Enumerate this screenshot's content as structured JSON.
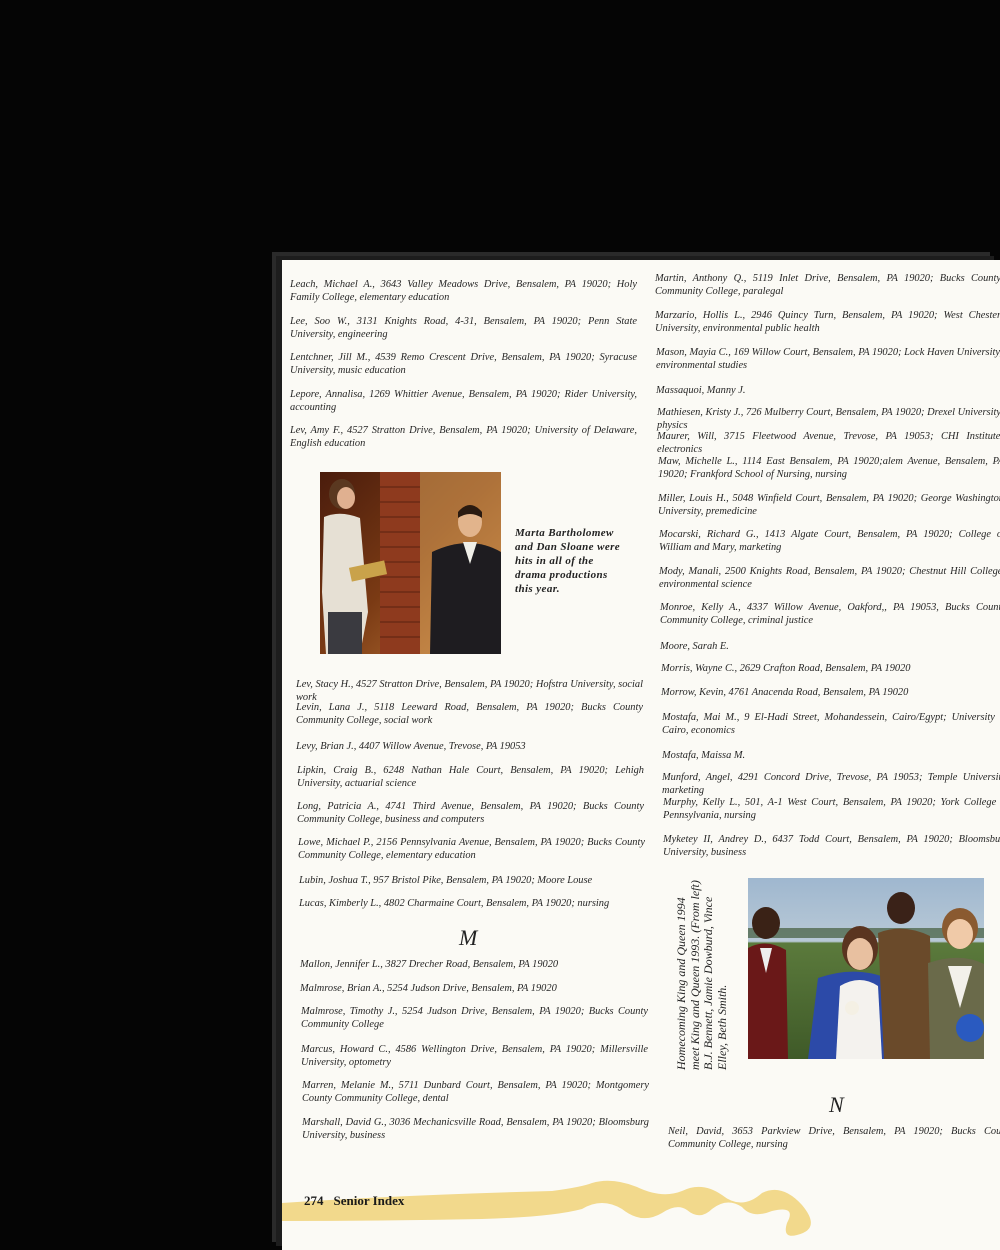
{
  "left_column": {
    "entries_top": [
      "Leach, Michael A., 3643 Valley Meadows Drive, Bensalem, PA 19020; Holy Family College, elementary education",
      "Lee, Soo W., 3131 Knights Road, 4-31, Bensalem, PA 19020; Penn State University, engineering",
      "Lentchner, Jill M., 4539 Remo Crescent Drive, Bensalem, PA 19020; Syracuse University, music education",
      "Lepore, Annalisa, 1269 Whittier Avenue, Bensalem, PA 19020; Rider University, accounting",
      "Lev, Amy F., 4527 Stratton Drive, Bensalem, PA 19020; University of Delaware, English education"
    ],
    "photo_caption": "Marta Bartholomew and Dan Sloane were hits in all of the drama productions this year.",
    "entries_middle": [
      "Lev, Stacy H., 4527 Stratton Drive, Bensalem, PA 19020; Hofstra University, social work",
      "Levin, Lana J., 5118 Leeward Road, Bensalem, PA 19020; Bucks County Community College, social work",
      "Levy, Brian J., 4407 Willow Avenue, Trevose, PA 19053",
      "Lipkin, Craig B., 6248 Nathan Hale Court, Bensalem, PA 19020; Lehigh University, actuarial science",
      "Long, Patricia A., 4741 Third Avenue, Bensalem, PA 19020; Bucks County Community College, business and computers",
      "Lowe, Michael P., 2156 Pennsylvania Avenue, Bensalem, PA 19020; Bucks County Community College, elementary education",
      "Lubin, Joshua T., 957 Bristol Pike, Bensalem, PA 19020; Moore Louse",
      "Lucas, Kimberly L., 4802 Charmaine Court, Bensalem, PA 19020; nursing"
    ],
    "section_letter": "M",
    "entries_m": [
      "Mallon, Jennifer L., 3827 Drecher Road, Bensalem, PA 19020",
      "Malmrose, Brian A., 5254 Judson Drive, Bensalem, PA 19020",
      "Malmrose, Timothy J., 5254 Judson Drive, Bensalem, PA 19020; Bucks County Community College",
      "Marcus, Howard C., 4586 Wellington Drive, Bensalem, PA 19020; Millersville University, optometry",
      "Marren, Melanie M., 5711 Dunbard Court, Bensalem, PA 19020; Montgomery County Community College, dental",
      "Marshall, David G., 3036 Mechanicsville Road, Bensalem, PA 19020; Bloomsburg University, business"
    ]
  },
  "right_column": {
    "entries": [
      "Martin, Anthony Q., 5119 Inlet Drive, Bensalem, PA 19020; Bucks County Community College, paralegal",
      "Marzario, Hollis L., 2946 Quincy Turn, Bensalem, PA 19020; West Chester University, environmental public health",
      "Mason, Mayia C., 169 Willow Court, Bensalem, PA 19020; Lock Haven University, environmental studies",
      "Massaquoi, Manny J.",
      "Mathiesen, Kristy J., 726 Mulberry Court, Bensalem, PA 19020; Drexel University, physics",
      "Maurer, Will, 3715 Fleetwood Avenue, Trevose, PA 19053; CHI Institute, electronics",
      "Maw, Michelle L., 1114 East Bensalem, PA 19020;alem Avenue, Bensalem, PA 19020; Frankford School of Nursing, nursing",
      "Miller, Louis H., 5048 Winfield Court, Bensalem, PA 19020; George Washington University, premedicine",
      "Mocarski, Richard G., 1413 Algate Court, Bensalem, PA 19020; College of William and Mary, marketing",
      "Mody, Manali, 2500 Knights Road, Bensalem, PA 19020; Chestnut Hill College, environmental science",
      "Monroe, Kelly A., 4337 Willow Avenue, Oakford,, PA 19053, Bucks County Community College, criminal justice",
      "Moore, Sarah E.",
      "Morris, Wayne C., 2629 Crafton Road, Bensalem, PA 19020",
      "Morrow, Kevin, 4761 Anacenda Road, Bensalem, PA 19020",
      "Mostafa, Mai M., 9 El-Hadi Street, Mohandessein, Cairo/Egypt; University of Cairo, economics",
      "Mostafa, Maissa M.",
      "Munford, Angel, 4291 Concord Drive, Trevose, PA 19053; Temple University, marketing",
      "Murphy, Kelly L., 501, A-1 West Court, Bensalem, PA 19020; York College of Pennsylvania, nursing",
      "Myketey II, Andrey D., 6437 Todd Court, Bensalem, PA 19020; Bloomsburg University, business"
    ],
    "photo_caption": "Homecoming King and Queen 1994 meet King and Queen 1993. (From left) B.J. Bennett, Jamie Dowburd, Vince Elley, Beth Smith.",
    "section_letter": "N",
    "entries_n": [
      "Neil, David, 3653 Parkview Drive, Bensalem, PA 19020; Bucks County Community College, nursing"
    ]
  },
  "footer": {
    "page_number": "274",
    "section": "Senior Index",
    "swoosh_color": "#f2d98c"
  }
}
